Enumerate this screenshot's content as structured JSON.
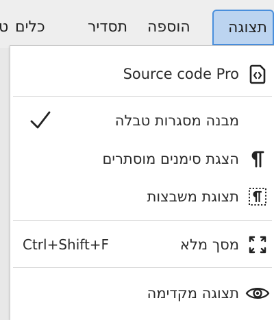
{
  "menubar": {
    "items": [
      {
        "label": "תצוגה",
        "active": true
      },
      {
        "label": "הוספה"
      },
      {
        "label": "תסדיר"
      },
      {
        "label": "כלים"
      },
      {
        "label": "ט"
      }
    ]
  },
  "dropdown": {
    "items": [
      {
        "label": "Source code Pro",
        "icon": "source-code-icon"
      },
      {
        "label": "מבנה מסגרות טבלה",
        "checked": true,
        "check_icon": "checkmark-icon"
      },
      {
        "label": "הצגת סימנים מוסתרים",
        "icon": "pilcrow-icon"
      },
      {
        "label": "תצוגת משבצות",
        "icon": "dotted-pilcrow-icon"
      },
      {
        "label": "מסך מלא",
        "shortcut": "Ctrl+Shift+F",
        "icon": "fullscreen-icon"
      },
      {
        "label": "תצוגה מקדימה",
        "icon": "eye-icon"
      }
    ]
  },
  "colors": {
    "active_tab_bg": "#bcd4f0",
    "active_tab_border": "#4a8fdc",
    "menu_bg": "#ffffff",
    "page_bg": "#e8e8e8"
  }
}
